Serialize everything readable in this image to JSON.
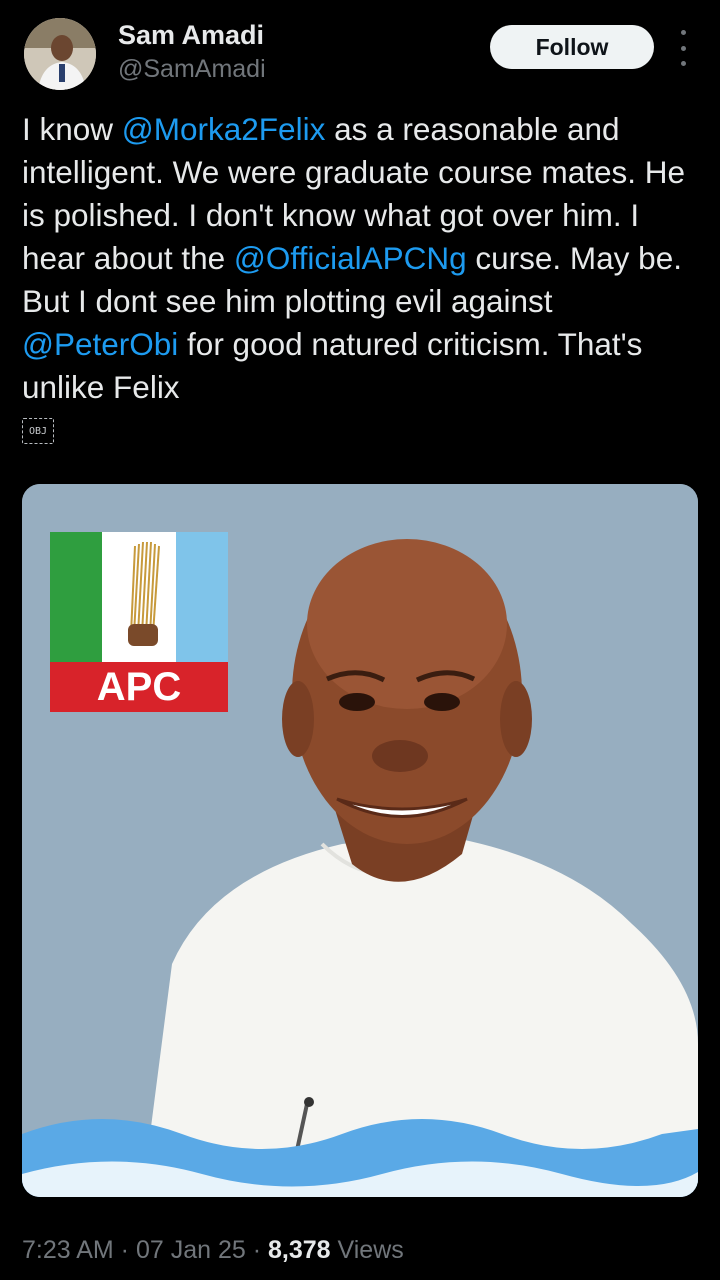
{
  "author": {
    "name": "Sam Amadi",
    "handle": "@SamAmadi"
  },
  "follow_label": "Follow",
  "tweet": {
    "t1": "I know ",
    "m1": "@Morka2Felix",
    "t2": " as a reasonable and intelligent. We were graduate course mates. He is polished. I don't know what got over him. I hear about the ",
    "m2": "@OfficialAPCNg",
    "t3": " curse. May be. But I dont see him plotting evil against ",
    "m3": "@PeterObi",
    "t4": " for good natured criticism. That's unlike Felix"
  },
  "obj_badge": "OBJ",
  "media": {
    "logo_text": "APC",
    "colors": {
      "background": "#97aec0",
      "green": "#2f9e3f",
      "red": "#d8232a",
      "wave": "#5aa9e6"
    }
  },
  "meta": {
    "time": "7:23 AM",
    "sep1": " · ",
    "date": "07 Jan 25",
    "sep2": " · ",
    "views_count": "8,378",
    "views_label": " Views"
  },
  "colors": {
    "background": "#000000",
    "text": "#e7e9ea",
    "secondary": "#71767b",
    "link": "#1d9bf0"
  }
}
